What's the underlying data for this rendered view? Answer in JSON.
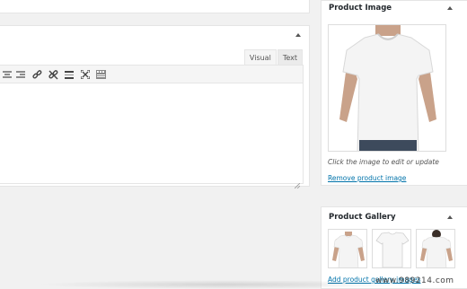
{
  "editor": {
    "tabs": [
      "Visual",
      "Text"
    ],
    "toolbar_icons": [
      "align-center-icon",
      "align-right-icon",
      "insert-link-icon",
      "remove-link-icon",
      "read-more-icon",
      "fullscreen-icon",
      "toolbar-toggle-icon"
    ]
  },
  "product_image": {
    "title": "Product Image",
    "hint": "Click the image to edit or update",
    "remove_label": "Remove product image"
  },
  "product_gallery": {
    "title": "Product Gallery",
    "add_label": "Add product gallery images"
  },
  "watermark": "www.989214.com",
  "colors": {
    "link": "#0073aa",
    "background": "#f1f1f1",
    "panel": "#ffffff"
  }
}
